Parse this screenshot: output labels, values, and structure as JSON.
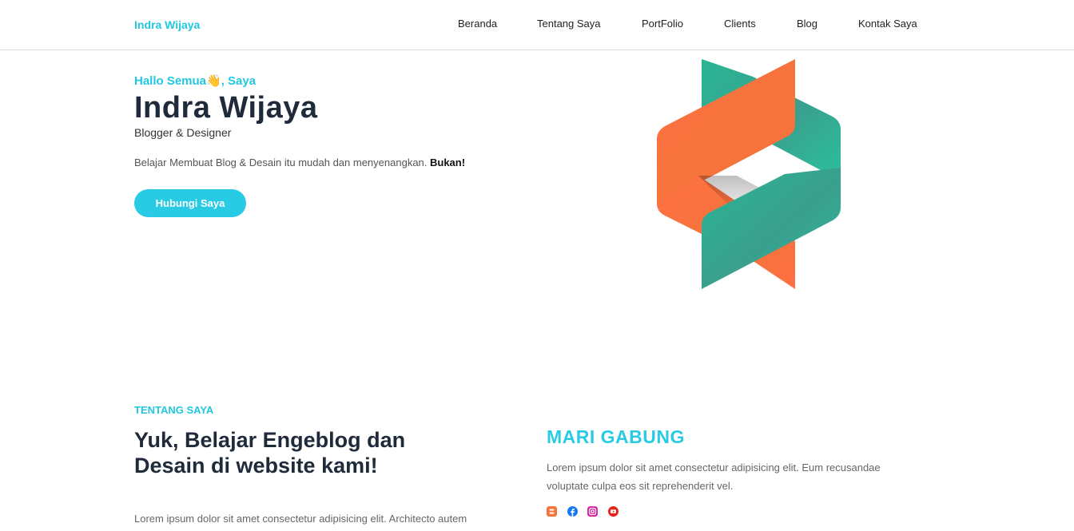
{
  "navbar": {
    "brand": "Indra Wijaya",
    "items": [
      {
        "label": "Beranda"
      },
      {
        "label": "Tentang Saya"
      },
      {
        "label": "PortFolio"
      },
      {
        "label": "Clients"
      },
      {
        "label": "Blog"
      },
      {
        "label": "Kontak Saya"
      }
    ]
  },
  "hero": {
    "greeting": "Hallo Semua👋, Saya",
    "name": "Indra Wijaya",
    "role": "Blogger & Designer",
    "description": "Belajar Membuat Blog & Desain itu mudah dan menyenangkan. ",
    "description_bold": "Bukan!",
    "button_label": "Hubungi Saya",
    "logo_colors": {
      "orange": "#ff7043",
      "teal": "#2ab594"
    }
  },
  "about": {
    "kicker": "TENTANG SAYA",
    "title": "Yuk, Belajar Engeblog dan Desain di website kami!",
    "text": "Lorem ipsum dolor sit amet consectetur adipisicing elit. Architecto autem"
  },
  "join": {
    "title": "MARI GABUNG",
    "text": "Lorem ipsum dolor sit amet consectetur adipisicing elit. Eum recusandae voluptate culpa eos sit reprehenderit vel."
  },
  "socials": [
    {
      "icon": "blogger-icon",
      "color": "#f4743b"
    },
    {
      "icon": "facebook-icon",
      "color": "#1877f2"
    },
    {
      "icon": "instagram-icon",
      "color": "#d6249f"
    },
    {
      "icon": "youtube-icon",
      "color": "#e62117"
    }
  ]
}
